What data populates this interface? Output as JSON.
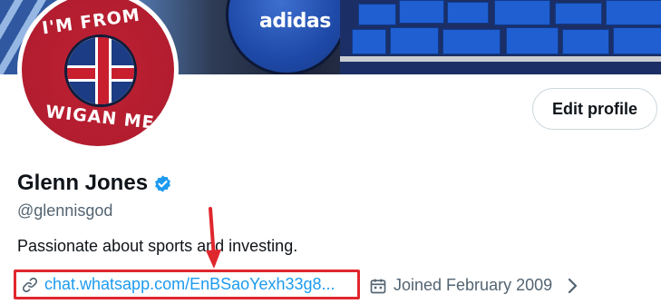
{
  "banner": {
    "brand_text": "adidas"
  },
  "avatar": {
    "line1": "I'M FROM",
    "line2": "WIGAN ME!"
  },
  "actions": {
    "edit_profile_label": "Edit profile"
  },
  "profile": {
    "name": "Glenn Jones",
    "handle": "@glennisgod",
    "bio": "Passionate about sports and investing.",
    "link_text": "chat.whatsapp.com/EnBSaoYexh33g8...",
    "joined_text": "Joined February 2009"
  },
  "icons": {
    "verified": "verified-badge-icon",
    "link": "link-icon",
    "calendar": "calendar-icon",
    "chevron": "chevron-right-icon",
    "annotation": "red-arrow-icon"
  },
  "colors": {
    "accent": "#1d9bf0",
    "highlight_box": "#e0272e",
    "secondary_text": "#536471",
    "primary_text": "#0f1419"
  }
}
